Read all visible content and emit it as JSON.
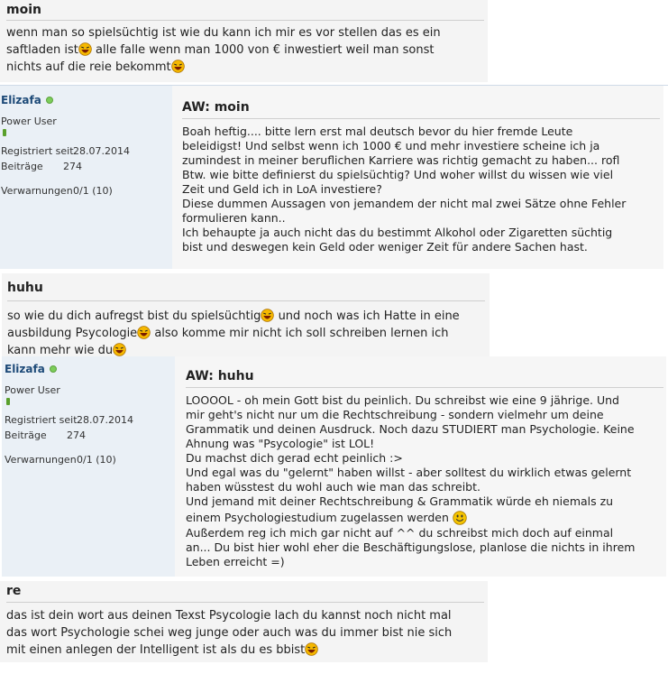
{
  "quotes": [
    {
      "title": "moin",
      "lines": [
        "wenn man so spielsüchtig ist wie du kann ich mir es vor stellen das es ein",
        "saftladen ist",
        " alle falle wenn man 1000 von € inwestiert weil man sonst",
        "nichts auf die reie bekommt"
      ]
    },
    {
      "title": "huhu",
      "lines": [
        "so wie du dich aufregst bist du spielsüchtig",
        " und noch was ich Hatte in eine",
        "ausbildung Psycologie",
        " also komme mir nicht ich soll schreiben lernen ich",
        "kann mehr wie du"
      ]
    },
    {
      "title": "re",
      "lines": [
        "das ist dein wort aus deinen Texst Psycologie lach du kannst noch nicht mal",
        "das wort Psychologie schei weg junge oder auch was du immer bist nie sich",
        "mit einen anlegen der Intelligent ist als du es bbist"
      ]
    }
  ],
  "posts": [
    {
      "username": "Elizafa",
      "rank": "Power User",
      "registered_label": "Registriert seit",
      "registered_value": "28.07.2014",
      "posts_label": "Beiträge",
      "posts_value": "274",
      "warnings_label": "Verwarnungen",
      "warnings_value": "0/1 (10)",
      "title": "AW: moin",
      "lines": [
        "Boah heftig.... bitte lern erst mal deutsch bevor du hier fremde Leute",
        "beleidigst! Und selbst wenn ich 1000 € und mehr investiere scheine ich ja",
        "zumindest in meiner beruflichen Karriere was richtig gemacht zu haben... rofl",
        "Btw. wie bitte definierst du spielsüchtig? Und woher willst du wissen wie viel",
        "Zeit und Geld ich in LoA investiere?",
        "Diese dummen Aussagen von jemandem der nicht mal zwei Sätze ohne Fehler",
        "formulieren kann..",
        "Ich behaupte ja auch nicht das du bestimmt Alkohol oder Zigaretten süchtig",
        "bist und deswegen kein Geld oder weniger Zeit für andere Sachen hast."
      ]
    },
    {
      "username": "Elizafa",
      "rank": "Power User",
      "registered_label": "Registriert seit",
      "registered_value": "28.07.2014",
      "posts_label": "Beiträge",
      "posts_value": "274",
      "warnings_label": "Verwarnungen",
      "warnings_value": "0/1 (10)",
      "title": "AW: huhu",
      "lines": [
        "LOOOOL - oh mein Gott bist du peinlich. Du schreibst wie eine 9 jährige. Und",
        "mir geht's nicht nur um die Rechtschreibung - sondern vielmehr um deine",
        "Grammatik und deinen Ausdruck. Noch dazu STUDIERT man Psychologie. Keine",
        "Ahnung was \"Psycologie\" ist LOL!",
        "Du machst dich gerad echt peinlich :>",
        "Und egal was du \"gelernt\" haben willst - aber solltest du wirklich etwas gelernt",
        "haben wüsstest du wohl auch wie man das schreibt.",
        "Und jemand mit deiner Rechtschreibung & Grammatik würde eh niemals zu",
        "einem Psychologiestudium zugelassen werden",
        "Außerdem reg ich mich gar nicht auf ^^ du schreibst mich doch auf einmal",
        "an... Du bist hier wohl eher die Beschäftigungslose, planlose die nichts in ihrem",
        "Leben erreicht =)"
      ]
    }
  ],
  "icons": {
    "laugh": "laughing-smiley-icon",
    "smile": "smile-icon",
    "online": "online-status-icon"
  },
  "colors": {
    "username": "#1d4a78",
    "sidebar_bg": "#eaf0f6",
    "quote_bg": "#f4f4f4",
    "online": "#7ccd5a",
    "smiley": "#f5b800"
  }
}
